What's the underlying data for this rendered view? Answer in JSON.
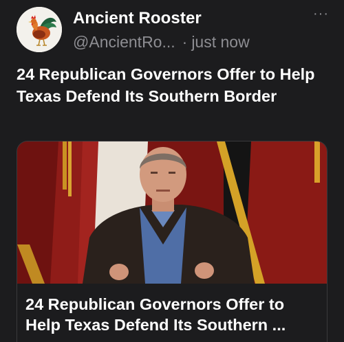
{
  "account": {
    "display_name": "Ancient Rooster",
    "handle": "@AncientRo...",
    "separator": "·",
    "timestamp": "just now",
    "avatar_icon": "rooster-icon"
  },
  "more_label": "···",
  "tweet": {
    "text": "24 Republican Governors Offer to Help Texas Defend Its Southern Border"
  },
  "card": {
    "title": "24 Republican Governors Offer to Help Texas Defend Its Southern ..."
  },
  "colors": {
    "background": "#1c1c1e",
    "primary_text": "#ffffff",
    "secondary_text": "#8e8e93",
    "card_border": "#3a3a3c"
  }
}
